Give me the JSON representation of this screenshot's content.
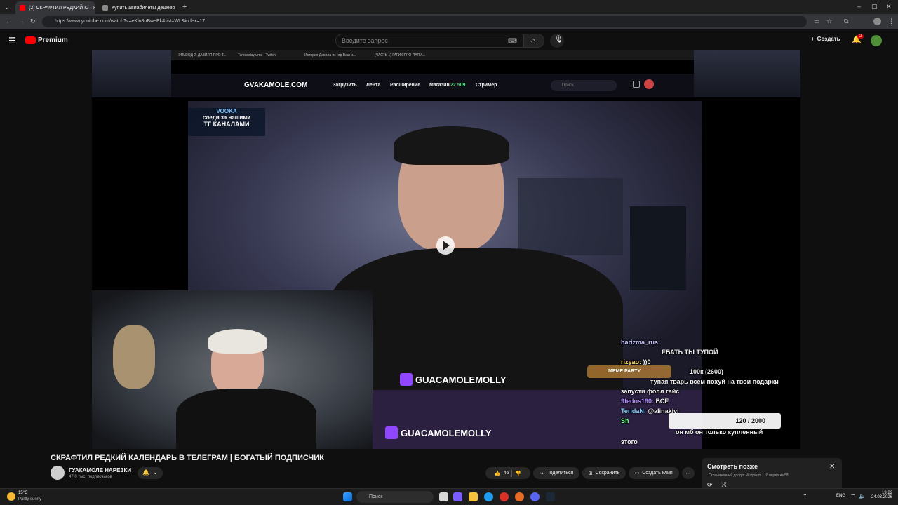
{
  "browser": {
    "tabs": [
      {
        "label": "(2) СКРАФТИЛ РЕДКИЙ К/",
        "active": true
      },
      {
        "label": "Купить авиабилеты дёшево",
        "active": false
      }
    ],
    "url": "https://www.youtube.com/watch?v=eKln8nBweEk&list=WL&index=17"
  },
  "youtube": {
    "logo": "Premium",
    "search_placeholder": "Введите запрос",
    "create_label": "Создать",
    "notif_count": "2"
  },
  "video": {
    "inner_tabs": [
      "ЭПИЗОД 2: ДАВИЛЯ ПРО Т...",
      "Tamisudayturna - Twitch",
      "История Давила из игр Ваш и...",
      "(ЧАСТЬ 1) ГАГИК ПРО ПАПИ..."
    ],
    "site": {
      "logo": "GVAKAMOLE.COM",
      "nav": [
        "Загрузить",
        "Лента",
        "Расширение",
        "Магазин"
      ],
      "shop_count": "22 509",
      "streamer": "Стример",
      "search_placeholder": "Поиск"
    },
    "overlay_banner": {
      "line1": "VOOKA",
      "line2": "следи за нашими",
      "line3": "ТГ КАНАЛАМИ"
    },
    "twitch_name": "GUACAMOLEMOLLY",
    "meme_party": "MEME PARTY",
    "progress_label": "120 / 2000",
    "chat": [
      {
        "user": "harizma_rus:",
        "text": ""
      },
      {
        "user": "",
        "text": "ЕБАТЬ ТЫ ТУПОЙ"
      },
      {
        "user": "rizyao:",
        "text": "))0"
      },
      {
        "user": "",
        "text": "100к (2600)"
      },
      {
        "user": "",
        "text": "тупая тварь всем похуй на твои подарки"
      },
      {
        "user": "",
        "text": "запусти фолл гайс"
      },
      {
        "user": "9fedos190:",
        "text": "ВСЕ"
      },
      {
        "user": "TeridaN:",
        "text": "@alinakivi"
      },
      {
        "user": "Sh",
        "text": ""
      },
      {
        "user": "",
        "text": "он мб он только купленный"
      },
      {
        "user": "",
        "text": "этого"
      }
    ]
  },
  "meta": {
    "title": "СКРАФТИЛ РЕДКИЙ КАЛЕНДАРЬ В ТЕЛЕГРАМ | БОГАТЫЙ ПОДПИСЧИК",
    "channel": "ГУАКАМОЛЕ НАРЕЗКИ",
    "subs": "47,0 тыс. подписчиков",
    "likes": "46",
    "share": "Поделиться",
    "save": "Сохранить",
    "clip": "Создать клип"
  },
  "watch_later": {
    "title": "Смотреть позже",
    "subtitle": "Ограниченный доступ Muzyskov · 16 видео из 58"
  },
  "taskbar": {
    "weather_temp": "15°C",
    "weather_desc": "Partly sunny",
    "search": "Поиск",
    "lang": "ENG",
    "time": "19:22",
    "date": "24.03.2026"
  }
}
